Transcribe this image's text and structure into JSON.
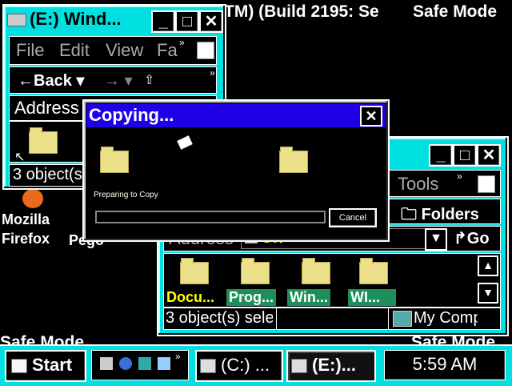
{
  "desktop": {
    "title_text": "TM) (Build 2195: Se",
    "safe_mode_top_right": "Safe Mode",
    "safe_mode_bottom_left": "Safe Mode",
    "safe_mode_bottom_right": "Safe Mode",
    "icons": [
      {
        "label_line1": "Mozilla",
        "label_line2": "Firefox"
      },
      {
        "label_line1": "Pego",
        "label_line2": ""
      }
    ]
  },
  "window_e": {
    "title": "(E:) Wind...",
    "menu": [
      "File",
      "Edit",
      "View",
      "Fa"
    ],
    "back_label": "Back",
    "address_label": "Address",
    "status": "3 object(s)"
  },
  "window_c": {
    "menu": [
      "Tools"
    ],
    "folders_label": "Folders",
    "address_label": "Address",
    "address_value": "C:\\",
    "go_label": "Go",
    "files": [
      "Docu...",
      "Prog...",
      "Win...",
      "WI..."
    ],
    "status": "3 object(s) sele",
    "status_right": "My Comp"
  },
  "dialog": {
    "title": "Copying...",
    "status": "Preparing to Copy",
    "cancel_label": "Cancel",
    "progress": 0
  },
  "taskbar": {
    "start_label": "Start",
    "tasks": [
      "(C:) ...",
      "(E:)..."
    ],
    "clock": "5:59 AM"
  },
  "colors": {
    "accent": "#00e0e0",
    "dialog_title": "#1f00e6",
    "folder": "#ece08a",
    "selection": "#1d8f5a"
  }
}
